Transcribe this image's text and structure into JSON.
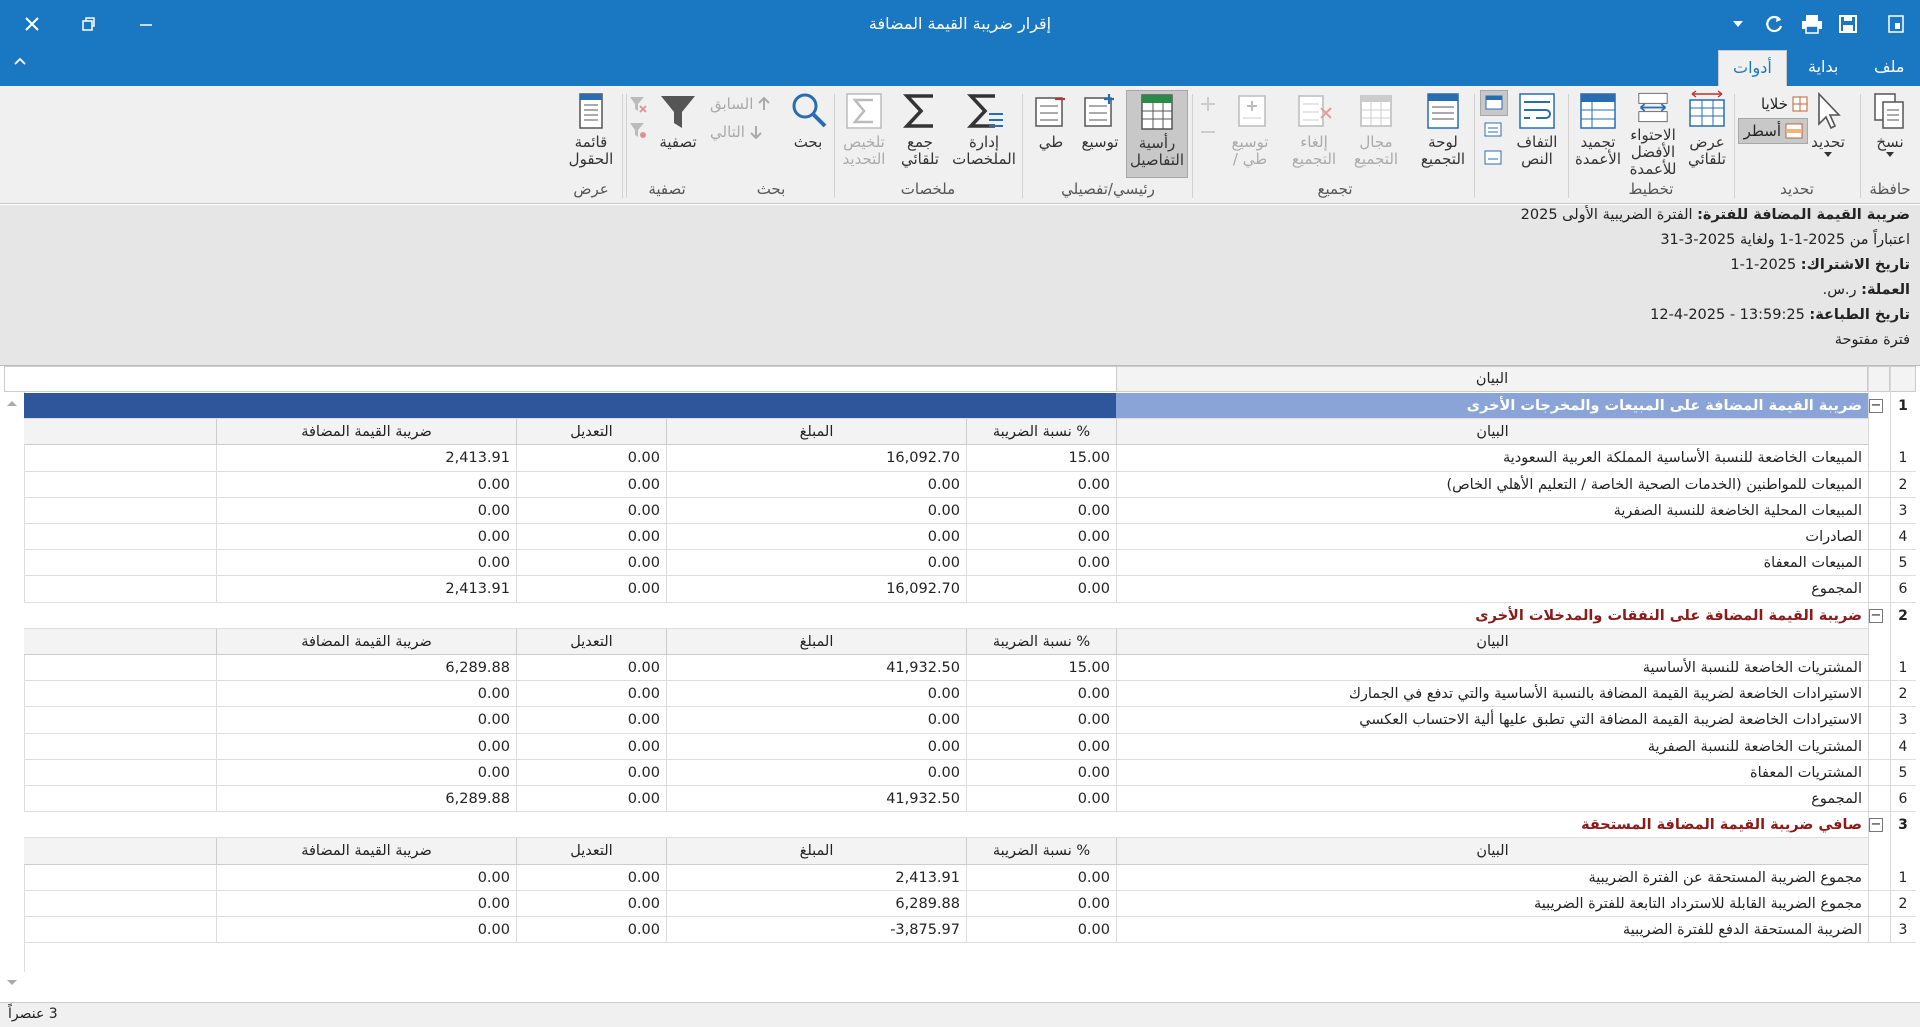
{
  "window": {
    "title": "إقرار ضريبة القيمة المضافة"
  },
  "tabs": [
    {
      "label": "ملف"
    },
    {
      "label": "بداية"
    },
    {
      "label": "أدوات"
    }
  ],
  "ribbon": {
    "copy": "نسخ",
    "select": "تحديد",
    "cells": "خلايا",
    "rows": "أسطر",
    "auto_width_1": "عرض",
    "auto_width_2": "تلقائي",
    "fit_columns_1": "الاحتواء",
    "fit_columns_2": "الأفضل",
    "fit_columns_3": "للأعمدة",
    "freeze_columns_1": "تجميد",
    "freeze_columns_2": "الأعمدة",
    "wrap_text_1": "التفاف",
    "wrap_text_2": "النص",
    "group_panel_1": "لوحة",
    "group_panel_2": "التجميع",
    "group_range_1": "مجال",
    "group_range_2": "التجميع",
    "ungroup_1": "إلغاء",
    "ungroup_2": "التجميع",
    "expand_collapse_1": "توسيع",
    "expand_collapse_2": "/ طي",
    "details_header_1": "رأسية",
    "details_header_2": "التفاصيل",
    "expand": "توسيع",
    "collapse": "طي",
    "manage_summaries_1": "إدارة",
    "manage_summaries_2": "الملخصات",
    "auto_sum_1": "جمع",
    "auto_sum_2": "تلقائي",
    "selection_summary_1": "تلخيص",
    "selection_summary_2": "التحديد",
    "search": "بحث",
    "previous": "السابق",
    "next": "التالي",
    "filter": "تصفية",
    "field_list_1": "قائمة",
    "field_list_2": "الحقول",
    "groups": {
      "clipboard": "حافظة",
      "selection": "تحديد",
      "layout": "تخطيط",
      "grouping": "تجميع",
      "master_detail": "رئيسي/تفصيلي",
      "summaries": "ملخصات",
      "search": "بحث",
      "filter": "تصفية",
      "view": "عرض"
    }
  },
  "info": {
    "period_label": "ضريبة القيمة المضافة للفترة:",
    "period_value": "الفترة الضريبية الأولى 2025",
    "from_to": "اعتباراً من  2025-1-1 ولغاية  2025-3-31",
    "subscription_label": "تاريخ الاشتراك:",
    "subscription_value": "2025-1-1",
    "currency_label": "العملة:",
    "currency_value": "ر.س.",
    "print_label": "تاريخ الطباعة:",
    "print_value": "13:59:25 - 2025-4-12",
    "period_status": "فترة مفتوحة"
  },
  "grid": {
    "header": "البيان",
    "columns": {
      "statement": "البيان",
      "rate": "نسبة الضريبة %",
      "amount": "المبلغ",
      "adjustment": "التعديل",
      "vat": "ضريبة القيمة المضافة"
    },
    "sections": [
      {
        "num": "1",
        "title": "ضريبة القيمة المضافة على المبيعات والمخرجات الأخرى",
        "rows": [
          {
            "n": "1",
            "label": "المبيعات الخاضعة للنسبة الأساسية المملكة العربية السعودية",
            "rate": "15.00",
            "amount": "16,092.70",
            "adj": "0.00",
            "vat": "2,413.91"
          },
          {
            "n": "2",
            "label": "المبيعات للمواطنين (الخدمات الصحية الخاصة / التعليم الأهلي الخاص)",
            "rate": "0.00",
            "amount": "0.00",
            "adj": "0.00",
            "vat": "0.00"
          },
          {
            "n": "3",
            "label": "المبيعات المحلية الخاضعة للنسبة الصفرية",
            "rate": "0.00",
            "amount": "0.00",
            "adj": "0.00",
            "vat": "0.00"
          },
          {
            "n": "4",
            "label": "الصادرات",
            "rate": "0.00",
            "amount": "0.00",
            "adj": "0.00",
            "vat": "0.00"
          },
          {
            "n": "5",
            "label": "المبيعات المعفاة",
            "rate": "0.00",
            "amount": "0.00",
            "adj": "0.00",
            "vat": "0.00"
          },
          {
            "n": "6",
            "label": "المجموع",
            "rate": "0.00",
            "amount": "16,092.70",
            "adj": "0.00",
            "vat": "2,413.91"
          }
        ]
      },
      {
        "num": "2",
        "title": "ضريبة القيمة المضافة على النفقات والمدخلات الأخرى",
        "rows": [
          {
            "n": "1",
            "label": "المشتريات الخاضعة للنسبة الأساسية",
            "rate": "15.00",
            "amount": "41,932.50",
            "adj": "0.00",
            "vat": "6,289.88"
          },
          {
            "n": "2",
            "label": "الاستيرادات الخاضعة لضريبة القيمة المضافة بالنسبة الأساسية والتي تدفع في الجمارك",
            "rate": "0.00",
            "amount": "0.00",
            "adj": "0.00",
            "vat": "0.00"
          },
          {
            "n": "3",
            "label": "الاستيرادات الخاضعة لضريبة القيمة المضافة التي تطبق عليها ألية الاحتساب العكسي",
            "rate": "0.00",
            "amount": "0.00",
            "adj": "0.00",
            "vat": "0.00"
          },
          {
            "n": "4",
            "label": "المشتريات الخاضعة للنسبة الصفرية",
            "rate": "0.00",
            "amount": "0.00",
            "adj": "0.00",
            "vat": "0.00"
          },
          {
            "n": "5",
            "label": "المشتريات المعفاة",
            "rate": "0.00",
            "amount": "0.00",
            "adj": "0.00",
            "vat": "0.00"
          },
          {
            "n": "6",
            "label": "المجموع",
            "rate": "0.00",
            "amount": "41,932.50",
            "adj": "0.00",
            "vat": "6,289.88"
          }
        ]
      },
      {
        "num": "3",
        "title": "صافي ضريبة القيمة المضافة المستحقة",
        "rows": [
          {
            "n": "1",
            "label": "مجموع الضريبة المستحقة عن الفترة الضريبية",
            "rate": "0.00",
            "amount": "2,413.91",
            "adj": "0.00",
            "vat": "0.00"
          },
          {
            "n": "2",
            "label": "مجموع الضريبة القابلة للاسترداد التابعة للفترة الضريبية",
            "rate": "0.00",
            "amount": "6,289.88",
            "adj": "0.00",
            "vat": "0.00"
          },
          {
            "n": "3",
            "label": "الضريبة المستحقة الدفع للفترة الضريبية",
            "rate": "0.00",
            "amount": "-3,875.97",
            "adj": "0.00",
            "vat": "0.00"
          }
        ]
      }
    ]
  },
  "status": {
    "count": "3 عنصراً"
  }
}
